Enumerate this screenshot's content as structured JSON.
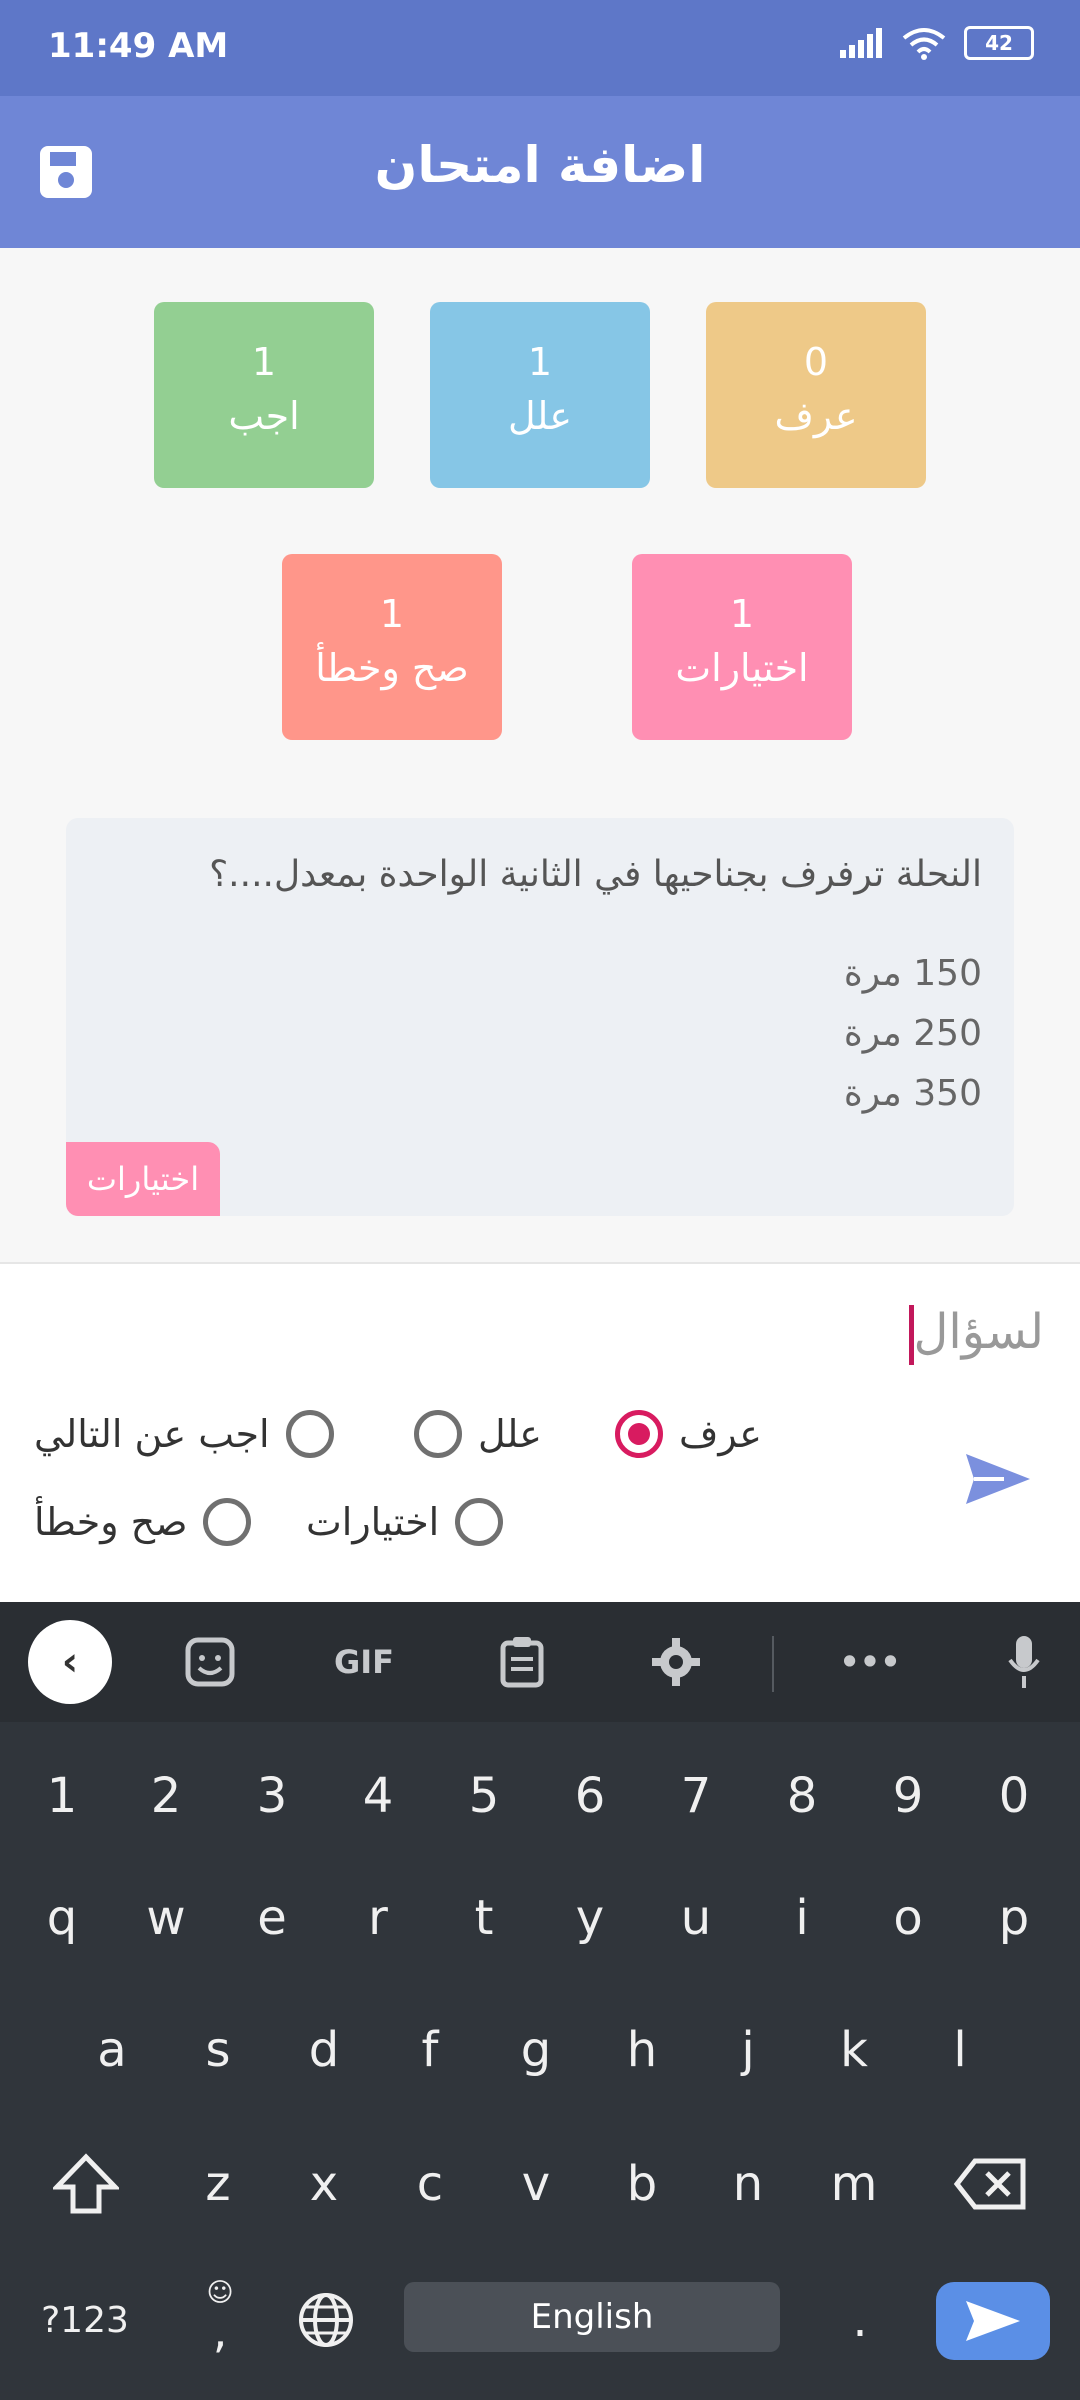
{
  "status_bar": {
    "time": "11:49 AM",
    "battery": "42"
  },
  "app_bar": {
    "title": "اضافة امتحان"
  },
  "counts": [
    {
      "count": "0",
      "label": "عرف",
      "color": "#eec988"
    },
    {
      "count": "1",
      "label": "علل",
      "color": "#86c6e6"
    },
    {
      "count": "1",
      "label": "اجب",
      "color": "#93cf92"
    },
    {
      "count": "1",
      "label": "اختيارات",
      "color": "#ff8fb3"
    },
    {
      "count": "1",
      "label": "صح وخطأ",
      "color": "#ff968a"
    }
  ],
  "question_card": {
    "question": "النحلة ترفرف بجناحيها في الثانية الواحدة بمعدل....؟",
    "options": [
      "150 مرة",
      "250 مرة",
      "350 مرة"
    ],
    "type_tag": "اختيارات"
  },
  "input": {
    "placeholder": "لسؤال"
  },
  "types": {
    "define": "عرف",
    "explain": "علل",
    "answer": "اجب عن التالي",
    "choices": "اختيارات",
    "truefalse": "صح وخطأ",
    "selected": "عرف"
  },
  "keyboard": {
    "gif_label": "GIF",
    "numbers": [
      "1",
      "2",
      "3",
      "4",
      "5",
      "6",
      "7",
      "8",
      "9",
      "0"
    ],
    "row1": [
      "q",
      "w",
      "e",
      "r",
      "t",
      "y",
      "u",
      "i",
      "o",
      "p"
    ],
    "row2": [
      "a",
      "s",
      "d",
      "f",
      "g",
      "h",
      "j",
      "k",
      "l"
    ],
    "row3": [
      "z",
      "x",
      "c",
      "v",
      "b",
      "n",
      "m"
    ],
    "symbols_label": "?123",
    "comma_label": ",",
    "space_label": "English",
    "period_label": "."
  }
}
